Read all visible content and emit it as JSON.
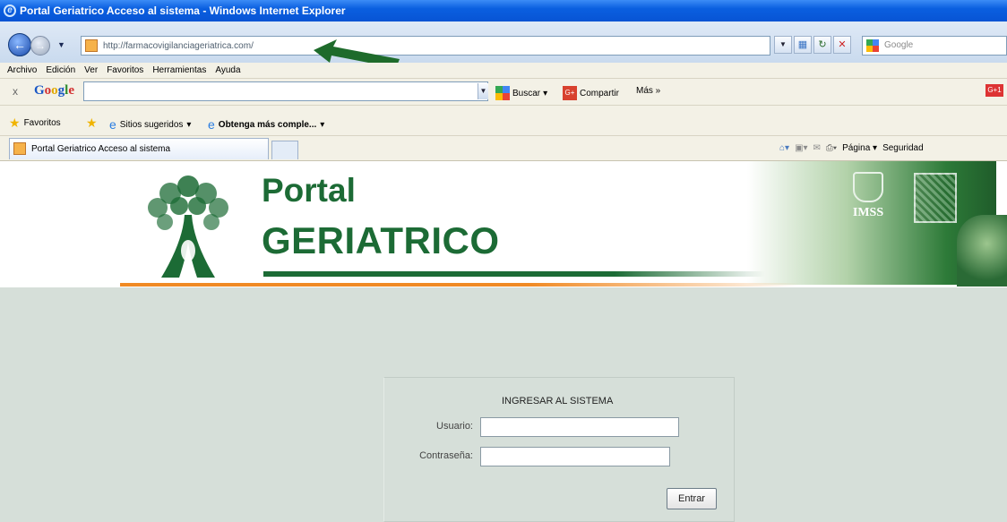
{
  "window": {
    "title": "Portal Geriatrico Acceso al sistema - Windows Internet Explorer"
  },
  "address_bar": {
    "url": "http://farmacovigilanciageriatrica.com/"
  },
  "search_bar": {
    "placeholder": "Google"
  },
  "menu": [
    "Archivo",
    "Edición",
    "Ver",
    "Favoritos",
    "Herramientas",
    "Ayuda"
  ],
  "google_toolbar": {
    "logo": [
      "G",
      "o",
      "o",
      "g",
      "l",
      "e"
    ],
    "buscar": "Buscar",
    "compartir": "Compartir",
    "mas": "Más »",
    "gplus": "G+1"
  },
  "favorites_bar": {
    "favoritos": "Favoritos",
    "sitios": "Sitios sugeridos",
    "obtenga": "Obtenga más comple..."
  },
  "tab": {
    "title": "Portal Geriatrico Acceso al sistema"
  },
  "command_bar": {
    "pagina": "Página",
    "seguridad": "Seguridad"
  },
  "banner": {
    "line1": "Portal",
    "line2": "GERIATRICO",
    "imss": "IMSS"
  },
  "login": {
    "heading": "INGRESAR AL SISTEMA",
    "user_label": "Usuario:",
    "password_label": "Contraseña:",
    "submit": "Entrar"
  },
  "colors": {
    "brand_green": "#1c6b35",
    "accent_orange": "#f08a24",
    "page_gray": "#d6dfd9"
  }
}
